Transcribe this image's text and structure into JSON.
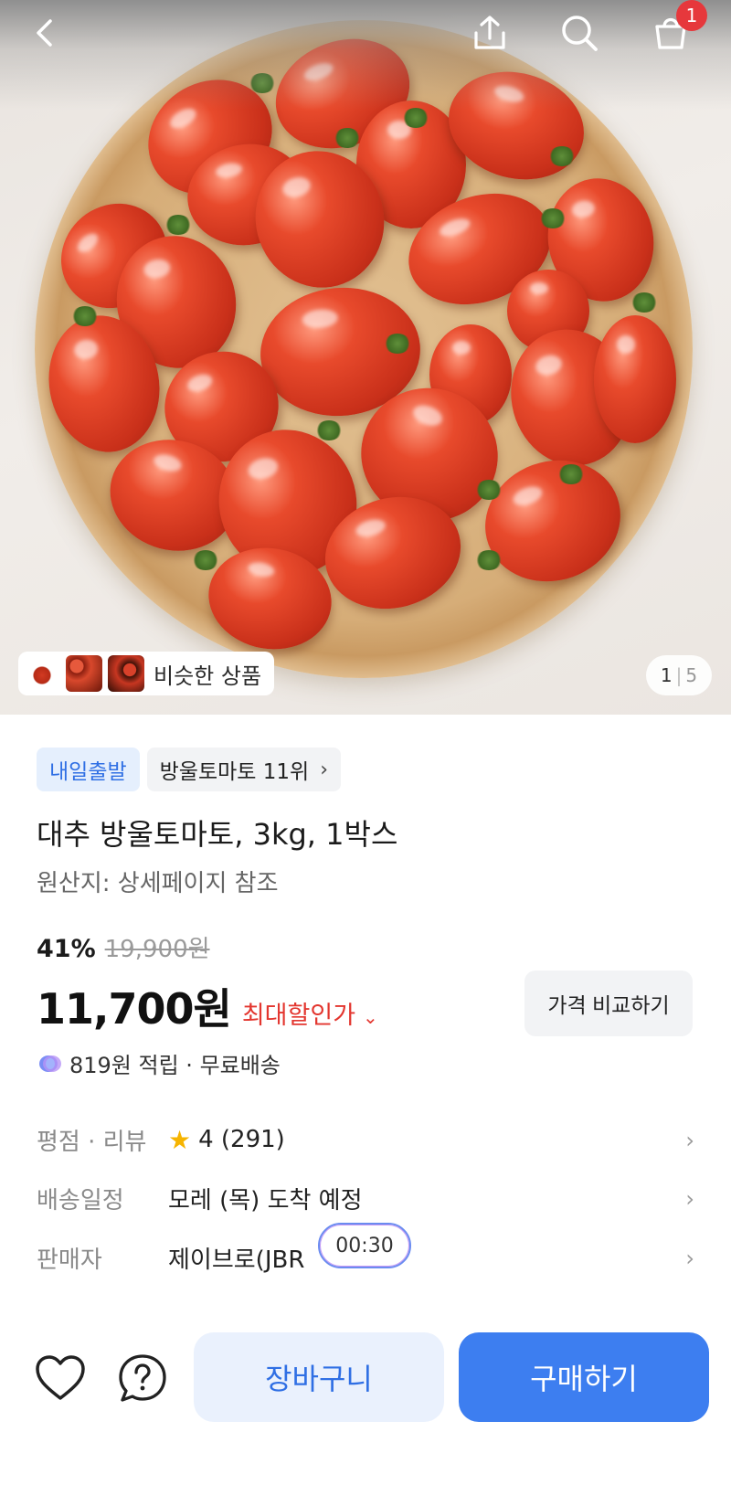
{
  "header": {
    "back_icon": "chevron-left-icon",
    "share_icon": "share-icon",
    "search_icon": "search-icon",
    "cart_icon": "cart-icon",
    "cart_badge_count": "1"
  },
  "gallery": {
    "similar_products_label": "비슷한 상품",
    "page_current": "1",
    "page_separator": "|",
    "page_total": "5"
  },
  "product": {
    "badge_delivery": "내일출발",
    "badge_ranking": "방울토마토 11위",
    "title": "대추 방울토마토, 3kg, 1박스",
    "origin": "원산지: 상세페이지 참조",
    "discount_percent": "41%",
    "original_price": "19,900원",
    "price": "11,700원",
    "max_discount_label": "최대할인가",
    "compare_price_button": "가격 비교하기",
    "reward_text": "819원 적립 · 무료배송"
  },
  "details": {
    "rating_label": "평점 · 리뷰",
    "rating_value": "4 (291)",
    "shipping_label": "배송일정",
    "shipping_value": "모레 (목) 도착 예정",
    "seller_label": "판매자",
    "seller_value": "제이브로(JBR",
    "timer_text": "00:30"
  },
  "bottom_bar": {
    "wishlist_icon": "heart-icon",
    "inquiry_icon": "question-icon",
    "add_to_cart_label": "장바구니",
    "buy_label": "구매하기"
  },
  "colors": {
    "accent_blue": "#3d7ef0",
    "discount_red": "#e3362f",
    "badge_red": "#e6383c",
    "star_yellow": "#f6b400"
  }
}
